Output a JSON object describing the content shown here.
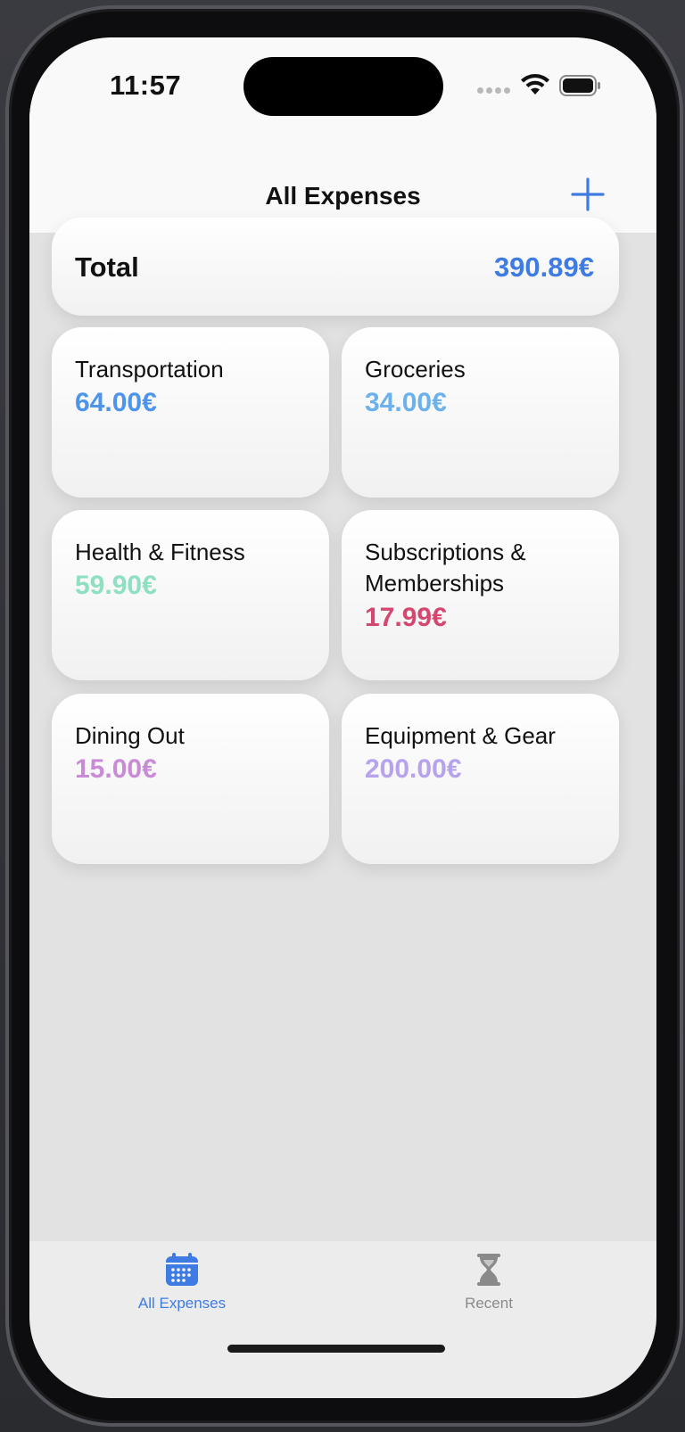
{
  "status_bar": {
    "time": "11:57"
  },
  "nav": {
    "title": "All Expenses"
  },
  "total": {
    "label": "Total",
    "value": "390.89€",
    "color": "#3e7be2"
  },
  "categories": [
    {
      "name": "Transportation",
      "amount": "64.00€",
      "color": "#4d95ea"
    },
    {
      "name": "Groceries",
      "amount": "34.00€",
      "color": "#6cb0ec"
    },
    {
      "name": "Health & Fitness",
      "amount": "59.90€",
      "color": "#8fe0c0"
    },
    {
      "name": "Subscriptions & Memberships",
      "amount": "17.99€",
      "color": "#d4486f"
    },
    {
      "name": "Dining Out",
      "amount": "15.00€",
      "color": "#c98bd6"
    },
    {
      "name": "Equipment & Gear",
      "amount": "200.00€",
      "color": "#b6a3ec"
    }
  ],
  "tab_bar": {
    "tabs": [
      {
        "label": "All Expenses",
        "icon": "calendar-icon",
        "active": true,
        "color": "#3e7be2"
      },
      {
        "label": "Recent",
        "icon": "hourglass-icon",
        "active": false,
        "color": "#8a8a8a"
      }
    ]
  }
}
